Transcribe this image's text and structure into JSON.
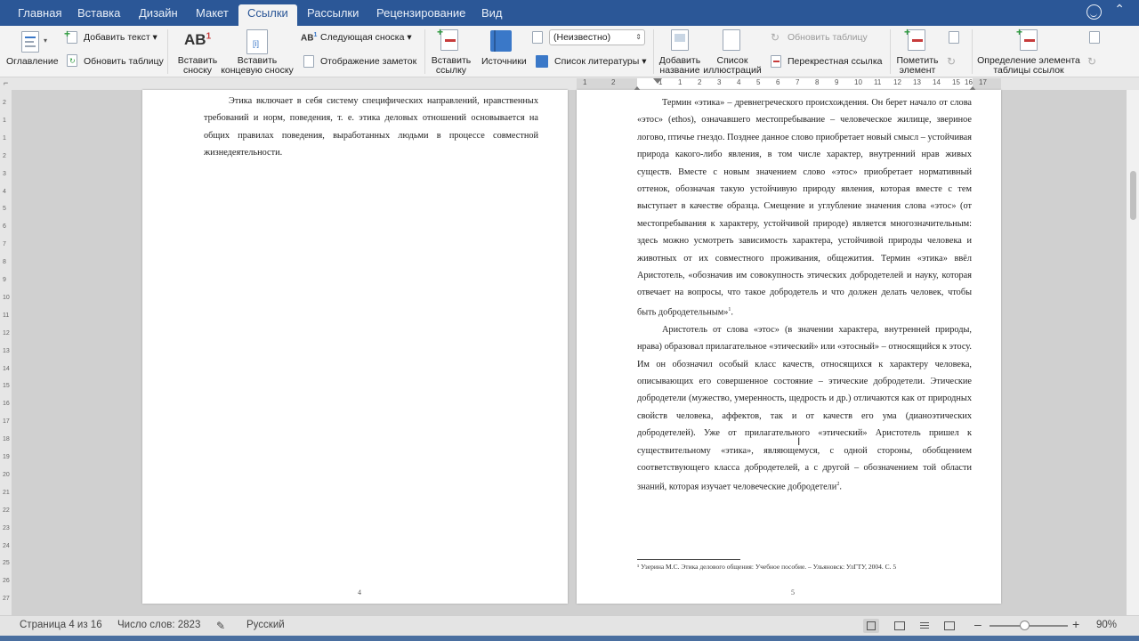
{
  "tabs": {
    "home": "Главная",
    "insert": "Вставка",
    "design": "Дизайн",
    "layout": "Макет",
    "references": "Ссылки",
    "mailings": "Рассылки",
    "review": "Рецензирование",
    "view": "Вид"
  },
  "ribbon": {
    "toc": "Оглавление",
    "add_text": "Добавить текст",
    "update_table": "Обновить таблицу",
    "insert_footnote_1": "Вставить",
    "insert_footnote_2": "сноску",
    "insert_endnote_1": "Вставить",
    "insert_endnote_2": "концевую сноску",
    "next_footnote": "Следующая сноска",
    "show_notes": "Отображение заметок",
    "insert_citation_1": "Вставить",
    "insert_citation_2": "ссылку",
    "sources": "Источники",
    "style_value": "(Неизвестно)",
    "bibliography": "Список литературы",
    "insert_caption_1": "Добавить",
    "insert_caption_2": "название",
    "table_of_figures_1": "Список",
    "table_of_figures_2": "иллюстраций",
    "update_table_figures": "Обновить таблицу",
    "cross_reference": "Перекрестная ссылка",
    "mark_entry_1": "Пометить",
    "mark_entry_2": "элемент",
    "mark_citation_1": "Определение элемента",
    "mark_citation_2": "таблицы ссылок"
  },
  "ruler": [
    "1",
    "2",
    "1",
    "1",
    "2",
    "3",
    "4",
    "5",
    "6",
    "7",
    "8",
    "9",
    "10",
    "11",
    "12",
    "13",
    "14",
    "15",
    "16",
    "17"
  ],
  "vruler": [
    "2",
    "1",
    "1",
    "2",
    "3",
    "4",
    "5",
    "6",
    "7",
    "8",
    "9",
    "10",
    "11",
    "12",
    "13",
    "14",
    "15",
    "16",
    "17",
    "18",
    "19",
    "20",
    "21",
    "22",
    "23",
    "24",
    "25",
    "26",
    "27"
  ],
  "page_left": {
    "paragraph": "Этика включает в себя систему специфических направлений, нравственных требований и норм, поведения, т. е. этика деловых отношений основывается на общих правилах поведения, выработанных людьми в процессе совместной жизнедеятельности.",
    "page_number": "4"
  },
  "page_right": {
    "paragraph1": "Термин «этика»  – древнегреческого происхождения. Он берет начало от слова «этос» (ethos), означавшего местопребывание – человеческое жилище, звериное логово, птичье гнездо. Позднее данное слово приобретает новый смысл  – устойчивая природа какого-либо явления, в том числе характер, внутренний нрав живых существ. Вместе с новым значением слово «этос» приобретает нормативный оттенок, обозначая такую устойчивую природу явления, которая вместе с тем выступает в качестве образца. Смещение и углубление значения слова «этос» (от местопребывания к характеру, устойчивой природе) является многозначительным: здесь можно усмотреть зависимость характера, устойчивой природы человека и животных от их совместного проживания, общежития. Термин «этика» ввёл Аристотель, «обозначив им совокупность этических добродетелей и науку, которая отвечает на вопросы, что такое добродетель и что должен делать человек, чтобы быть добродетельным»",
    "fn1": "1",
    "paragraph2": "Аристотель от слова «этос»  (в значении характера, внутренней природы, нрава) образовал прилагательное «этический» или «этосный» – относящийся к этосу. Им он обозначил особый класс качеств, относящихся к характеру человека, описывающих его совершенное состояние  – этические добродетели. Этические добродетели (мужество, умеренность, щедрость и др.) отличаются как от природных свойств человека, аффектов, так и от качеств его ума (дианоэтических добродетелей). Уже от прилагательного «этический»  Аристотель  пришел  к  существительному  «этика», являющемуся, с одной стороны, обобщением соответствующего класса добродетелей, а с другой  – обозначением той области знаний, которая изучает человеческие добродетели",
    "fn2": "2",
    "footnote": "¹ Узерина М.С. Этика делового общения: Учебное пособие.  – Ульяновск: УлГТУ, 2004. С. 5",
    "page_number": "5"
  },
  "status": {
    "page": "Страница 4 из 16",
    "words": "Число слов: 2823",
    "language": "Русский",
    "zoom": "90%"
  }
}
